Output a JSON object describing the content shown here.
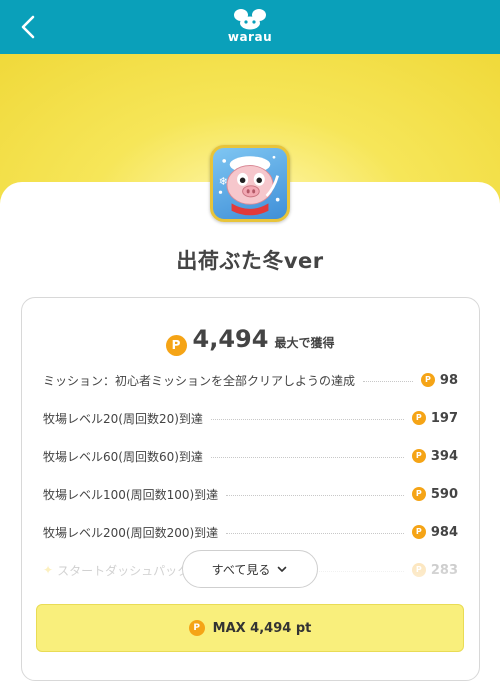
{
  "header": {
    "logo_text": "warau",
    "back_icon": "chevron-left-icon",
    "background_color": "#0aa0ba"
  },
  "app": {
    "title": "出荷ぶた冬ver",
    "icon": "pig-app-icon"
  },
  "points": {
    "coin_symbol": "P",
    "total": "4,494",
    "total_suffix": "最大で獲得",
    "coin_color": "#f5a416"
  },
  "missions": [
    {
      "label": "ミッション：初心者ミッションを全部クリアしようの達成",
      "points": "98"
    },
    {
      "label": "牧場レベル20(周回数20)到達",
      "points": "197"
    },
    {
      "label": "牧場レベル60(周回数60)到達",
      "points": "394"
    },
    {
      "label": "牧場レベル100(周回数100)到達",
      "points": "590"
    },
    {
      "label": "牧場レベル200(周回数200)到達",
      "points": "984"
    },
    {
      "label": "スタートダッシュパック",
      "points": "283"
    }
  ],
  "see_all": {
    "label": "すべて見る",
    "icon": "chevron-down-icon"
  },
  "max_button": {
    "label": "MAX 4,494 pt",
    "background_color": "#f9ef7c"
  }
}
